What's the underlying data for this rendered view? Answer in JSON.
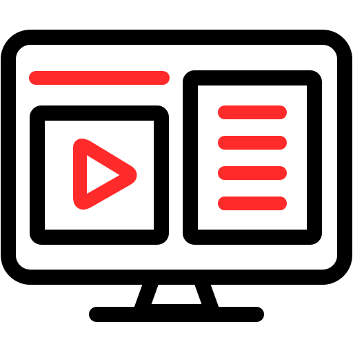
{
  "icon": {
    "name": "video-webpage-monitor-icon",
    "colors": {
      "outline": "#000000",
      "accent": "#ff2a2a",
      "background": "#ffffff"
    }
  },
  "monitor": {
    "screen": {
      "title_bar": {
        "shape": "rounded-line",
        "color_role": "accent"
      },
      "video_panel": {
        "play_button": {
          "icon": "play-triangle-icon",
          "color_role": "accent"
        }
      },
      "text_panel": {
        "line_count": 4,
        "line_color_role": "accent"
      }
    },
    "stand": {
      "shape": "trapezoid-neck-with-base"
    }
  }
}
